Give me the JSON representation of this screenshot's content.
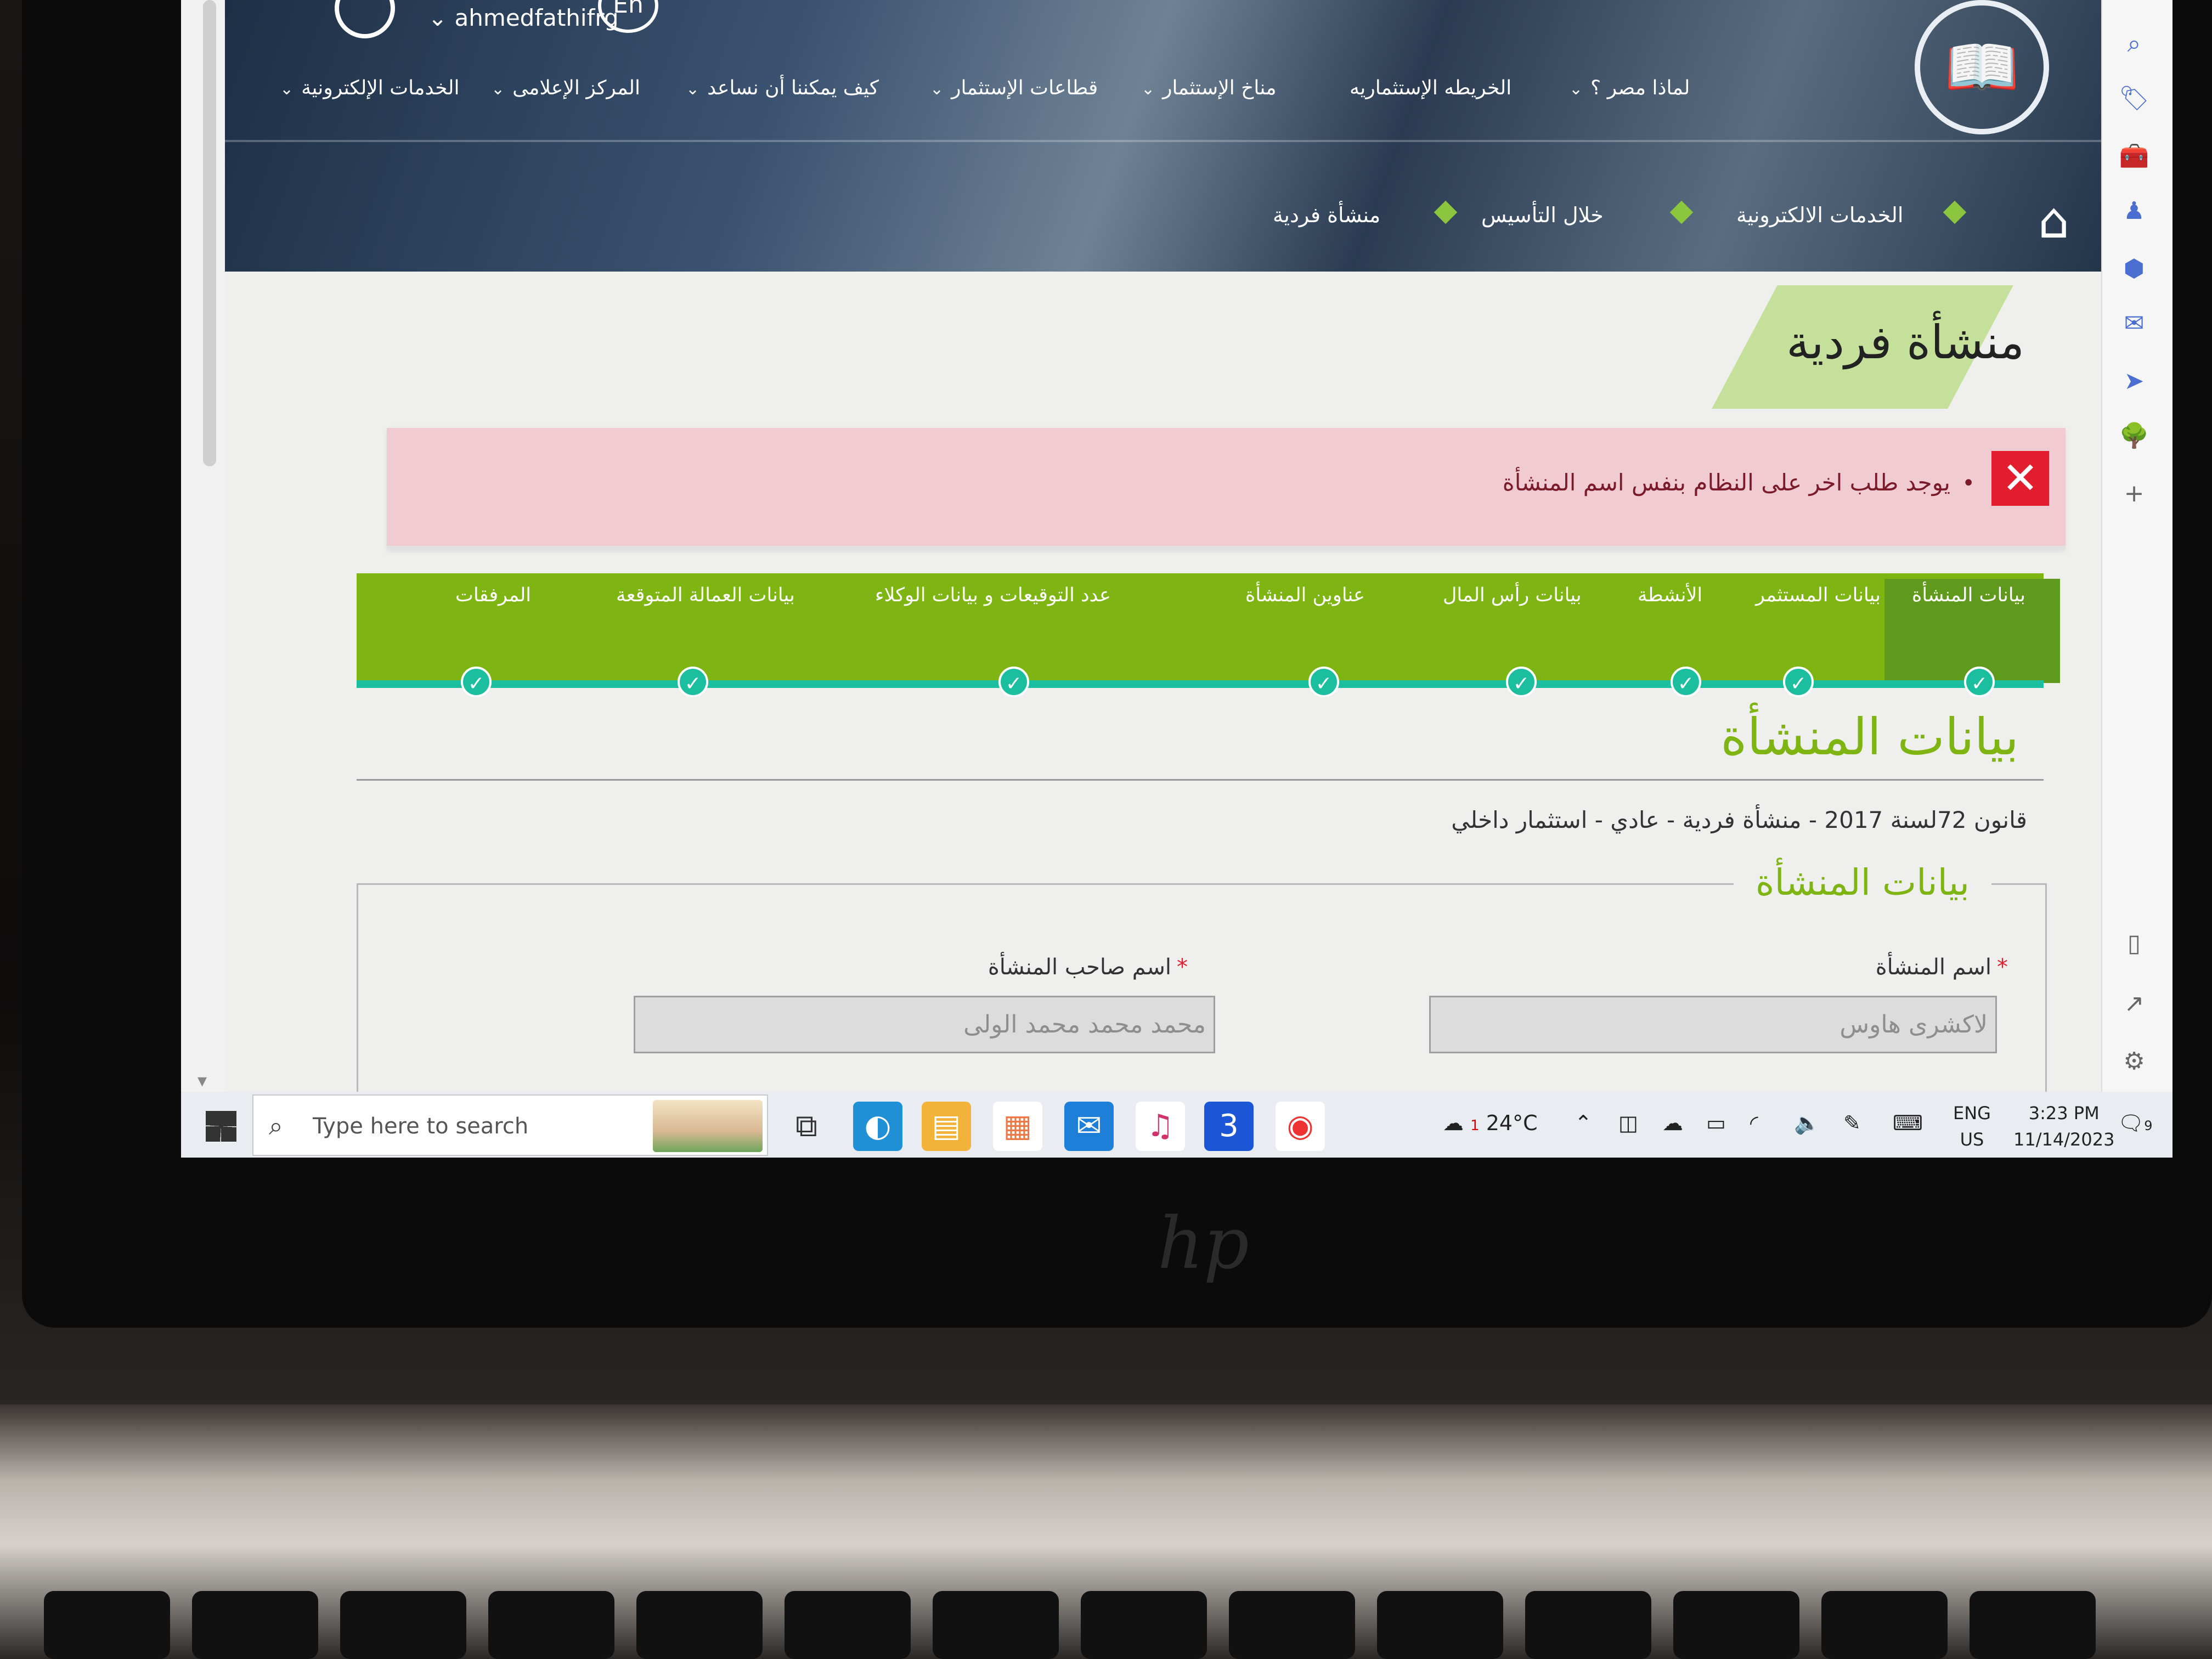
{
  "header": {
    "username": "ahmedfathifrg",
    "language_toggle": "En",
    "nav": [
      {
        "label": "لماذا مصر ؟",
        "has_dropdown": true
      },
      {
        "label": "الخريطه الإستثماريه",
        "has_dropdown": false
      },
      {
        "label": "مناخ الإستثمار",
        "has_dropdown": true
      },
      {
        "label": "قطاعات الإستثمار",
        "has_dropdown": true
      },
      {
        "label": "كيف يمكننا أن نساعد",
        "has_dropdown": true
      },
      {
        "label": "المركز الإعلامى",
        "has_dropdown": true
      },
      {
        "label": "الخدمات الإلكترونية",
        "has_dropdown": true
      }
    ],
    "breadcrumb": [
      "الخدمات الالكترونية",
      "خلال التأسيس",
      "منشأة فردية"
    ]
  },
  "page_title": "منشأة فردية",
  "alert": {
    "message": "يوجد طلب اخر على النظام بنفس اسم المنشأة"
  },
  "steps": [
    {
      "label": "بيانات المنشأة",
      "active": true,
      "done": true
    },
    {
      "label": "بيانات المستثمر",
      "active": false,
      "done": true
    },
    {
      "label": "الأنشطة",
      "active": false,
      "done": true
    },
    {
      "label": "بيانات رأس المال",
      "active": false,
      "done": true
    },
    {
      "label": "عناوين المنشأة",
      "active": false,
      "done": true
    },
    {
      "label": "عدد التوقيعات و بيانات الوكلاء",
      "active": false,
      "done": true
    },
    {
      "label": "بيانات العمالة المتوقعة",
      "active": false,
      "done": true
    },
    {
      "label": "المرفقات",
      "active": false,
      "done": true
    }
  ],
  "section": {
    "title": "بيانات المنشأة",
    "subtitle": "قانون 72لسنة 2017 - منشأة فردية - عادي - استثمار داخلي",
    "legend": "بيانات المنشأة",
    "fields": {
      "company_name_label": "اسم المنشأة",
      "company_name_value": "لاكشرى هاوس",
      "owner_name_label": "اسم صاحب المنشأة",
      "owner_name_value": "محمد محمد محمد الولى",
      "required_mark": "*"
    }
  },
  "taskbar": {
    "search_placeholder": "Type here to search",
    "weather": "24°C",
    "weather_badge": "1",
    "input_lang_top": "ENG",
    "input_lang_bottom": "US",
    "time": "3:23 PM",
    "date": "11/14/2023",
    "notification_count": "9"
  },
  "colors": {
    "accent_green": "#7fb512",
    "active_step_green": "#5f9a1c",
    "progress_teal": "#1bbfa0",
    "alert_bg": "#f1cbd2",
    "alert_red": "#e21d2e"
  },
  "icons": [
    "search-icon",
    "chevron-down-icon",
    "home-icon",
    "close-icon",
    "check-icon",
    "windows-start-icon",
    "task-view-icon",
    "edge-icon",
    "file-explorer-icon",
    "store-icon",
    "mail-icon",
    "itunes-icon",
    "app-3-icon",
    "chrome-icon",
    "weather-icon",
    "wifi-icon",
    "volume-icon",
    "battery-icon",
    "keyboard-icon",
    "notification-icon"
  ]
}
